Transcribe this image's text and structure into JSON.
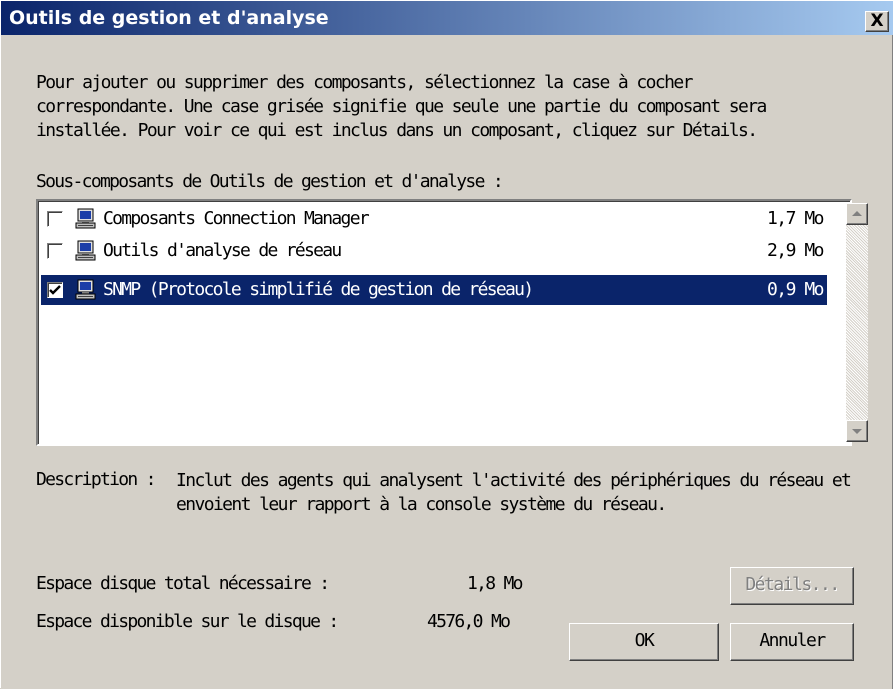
{
  "window": {
    "title": "Outils de gestion et d'analyse",
    "close_label": "X"
  },
  "intro_lines": [
    "Pour ajouter ou supprimer des composants, sélectionnez la case à cocher",
    "correspondante. Une case grisée signifie que seule une partie du composant sera",
    "installée. Pour voir ce qui est inclus dans un composant, cliquez sur Détails."
  ],
  "subcomponents_label": "Sous-composants de Outils de gestion et d'analyse :",
  "components": [
    {
      "name": "Composants Connection Manager",
      "size": "1,7 Mo",
      "checked": false,
      "selected": false
    },
    {
      "name": "Outils d'analyse de réseau",
      "size": "2,9 Mo",
      "checked": false,
      "selected": false
    },
    {
      "name": "SNMP (Protocole simplifié de gestion de réseau)",
      "size": "0,9 Mo",
      "checked": true,
      "selected": true
    }
  ],
  "description": {
    "label": "Description :",
    "lines": [
      "Inclut des agents qui analysent l'activité des périphériques du réseau et",
      "envoient leur rapport à la console système du réseau."
    ]
  },
  "disk": {
    "total_label": "Espace disque total nécessaire :",
    "total_value": "1,8 Mo",
    "available_label": "Espace disponible sur le disque :",
    "available_value": "4576,0 Mo"
  },
  "buttons": {
    "details": "Détails...",
    "ok": "OK",
    "cancel": "Annuler"
  },
  "colors": {
    "titlebar_start": "#0a246a",
    "titlebar_end": "#a6caf0",
    "selection": "#0a246a",
    "face": "#d4d0c8"
  }
}
